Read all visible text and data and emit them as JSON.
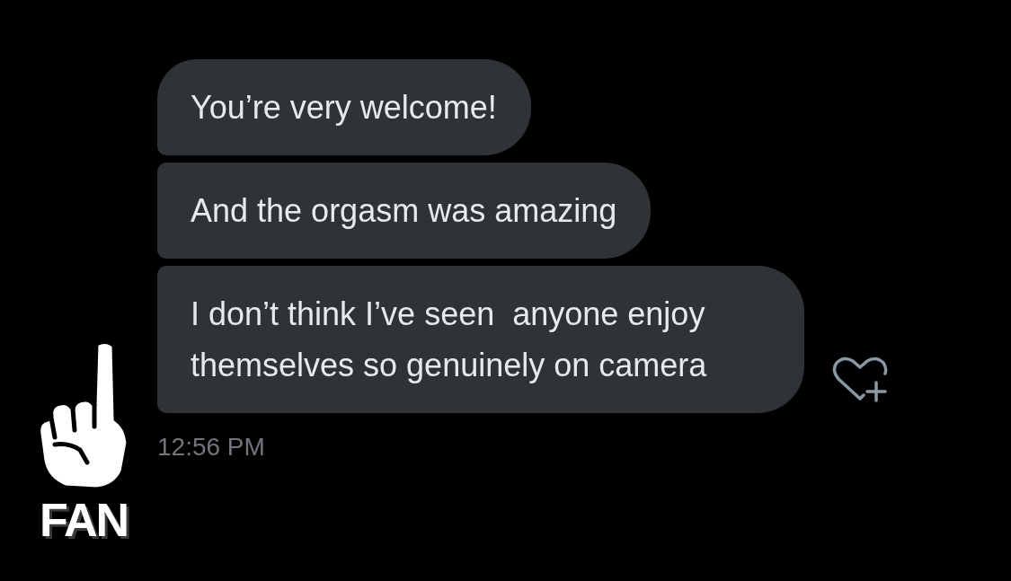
{
  "avatar": {
    "label": "FAN"
  },
  "messages": [
    {
      "text": "You’re very welcome!"
    },
    {
      "text": "And the orgasm was amazing"
    },
    {
      "text": "I don’t think I’ve seen  anyone enjoy themselves so genuinely on camera"
    }
  ],
  "timestamp": "12:56 PM"
}
